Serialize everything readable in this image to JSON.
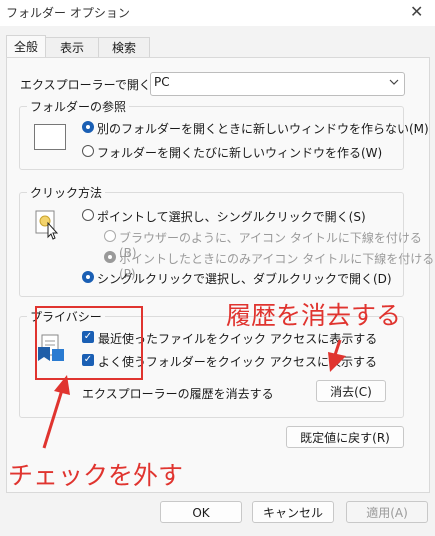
{
  "window": {
    "title": "フォルダー オプション",
    "close_glyph": "✕"
  },
  "tabs": [
    {
      "label": "全般"
    },
    {
      "label": "表示"
    },
    {
      "label": "検索"
    }
  ],
  "open_explorer": {
    "label": "エクスプローラーで開く:",
    "value": "PC"
  },
  "browse": {
    "legend": "フォルダーの参照",
    "options": [
      {
        "label": "別のフォルダーを開くときに新しいウィンドウを作らない(M)",
        "selected": true
      },
      {
        "label": "フォルダーを開くたびに新しいウィンドウを作る(W)",
        "selected": false
      }
    ]
  },
  "click": {
    "legend": "クリック方法",
    "options": [
      {
        "label": "ポイントして選択し、シングルクリックで開く(S)"
      },
      {
        "label": "ブラウザーのように、アイコン タイトルに下線を付ける(B)"
      },
      {
        "label": "ポイントしたときにのみアイコン タイトルに下線を付ける(P)"
      },
      {
        "label": "シングルクリックで選択し、ダブルクリックで開く(D)"
      }
    ]
  },
  "privacy": {
    "legend": "プライバシー",
    "check1": "最近使ったファイルをクイック アクセスに表示する",
    "check2": "よく使うフォルダーをクイック アクセスに表示する",
    "clear_label": "エクスプローラーの履歴を消去する",
    "clear_button": "消去(C)"
  },
  "restore_button": "既定値に戻す(R)",
  "footer": {
    "ok": "OK",
    "cancel": "キャンセル",
    "apply": "適用(A)"
  },
  "annotations": {
    "clear_history": "履歴を消去する",
    "uncheck": "チェックを外す"
  },
  "colors": {
    "accent": "#1a5fb4",
    "annotation": "#e0342f"
  }
}
